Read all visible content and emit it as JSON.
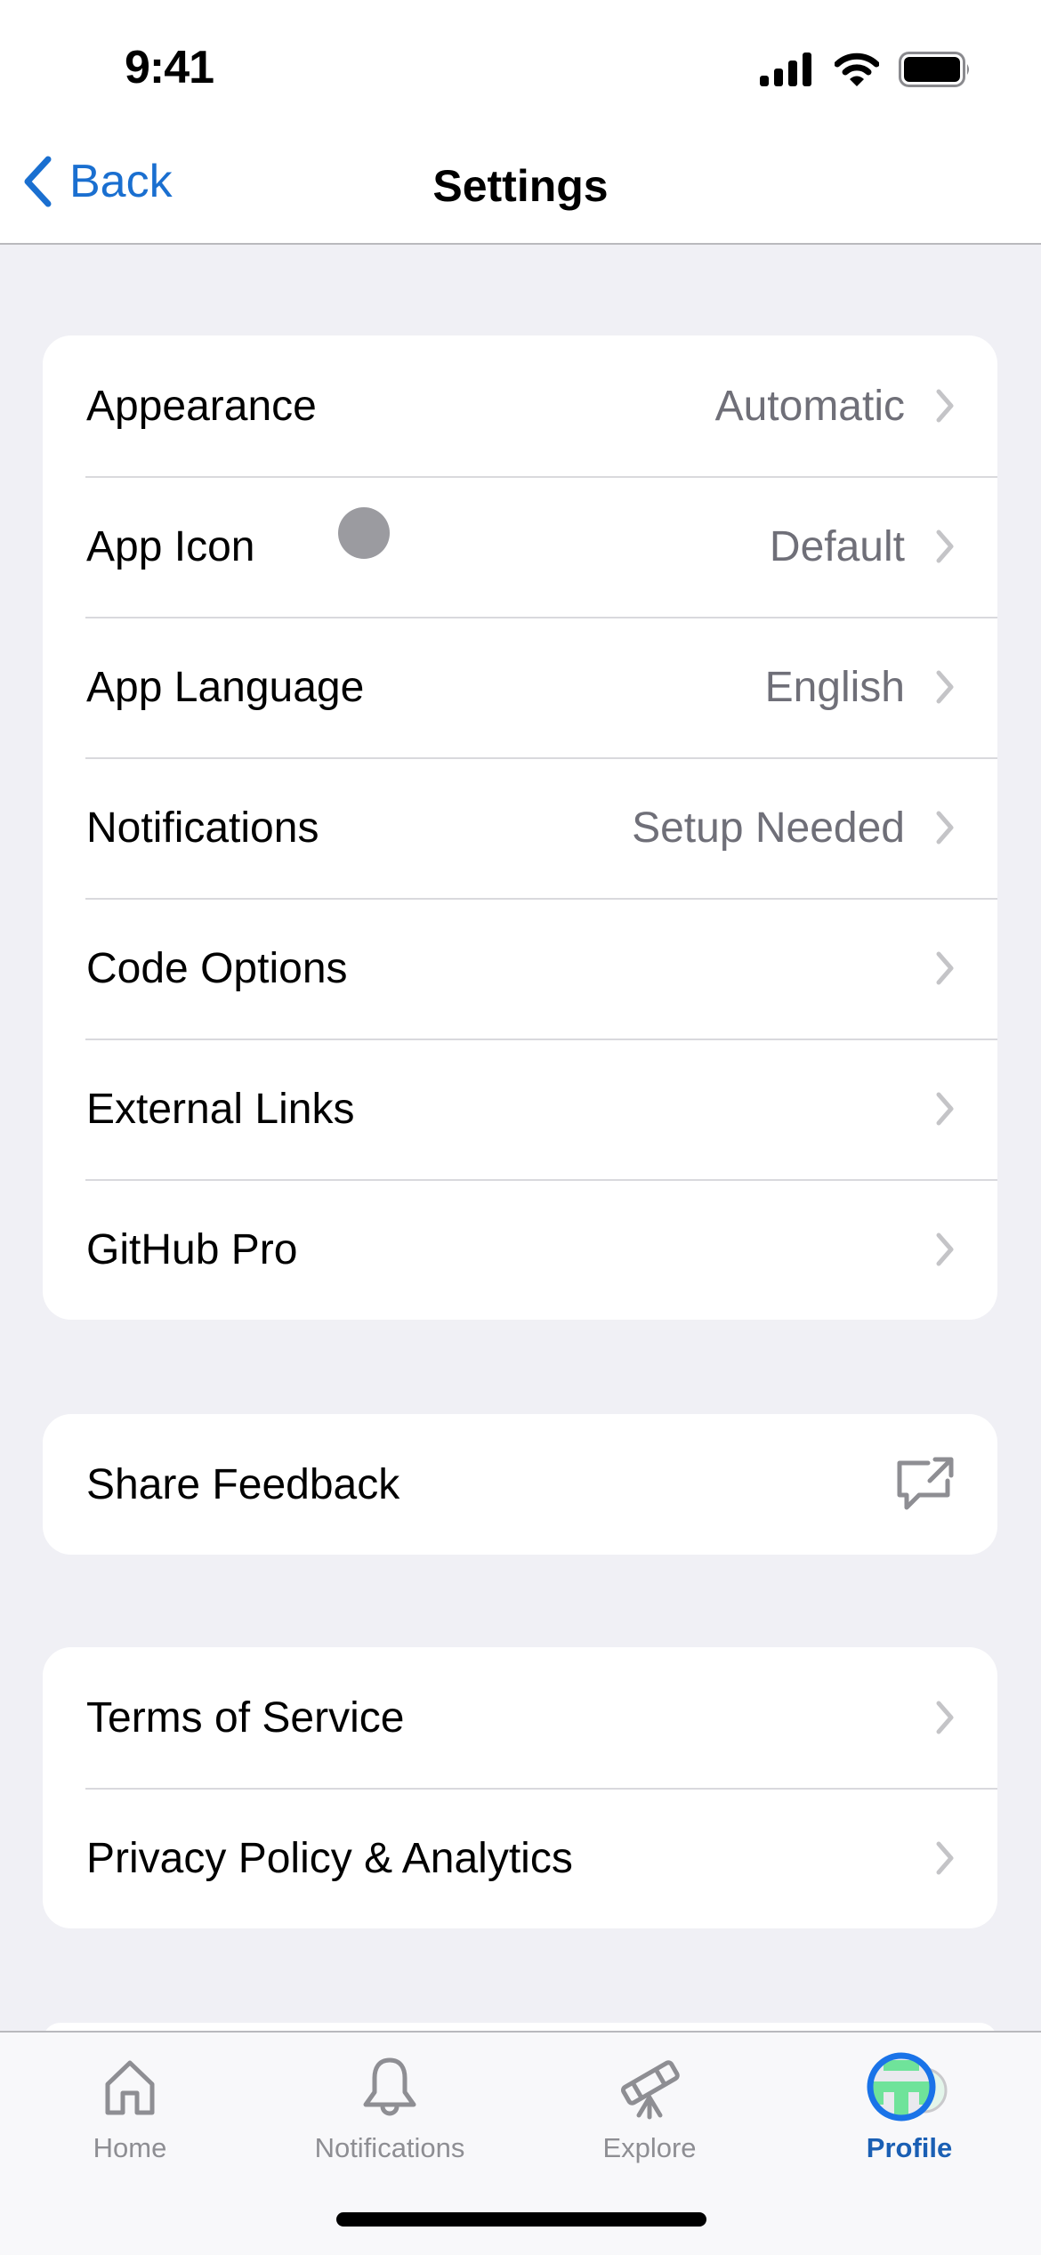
{
  "status_bar": {
    "time": "9:41",
    "icons": [
      "cellular-signal-icon",
      "wifi-icon",
      "battery-icon"
    ]
  },
  "nav": {
    "back_label": "Back",
    "back_icon": "chevron-left-icon",
    "title": "Settings"
  },
  "sections": [
    {
      "rows": [
        {
          "label": "Appearance",
          "value": "Automatic",
          "accessory": "chevron-right-icon"
        },
        {
          "label": "App Icon",
          "value": "Default",
          "accessory": "chevron-right-icon"
        },
        {
          "label": "App Language",
          "value": "English",
          "accessory": "chevron-right-icon"
        },
        {
          "label": "Notifications",
          "value": "Setup Needed",
          "accessory": "chevron-right-icon"
        },
        {
          "label": "Code Options",
          "value": "",
          "accessory": "chevron-right-icon"
        },
        {
          "label": "External Links",
          "value": "",
          "accessory": "chevron-right-icon"
        },
        {
          "label": "GitHub Pro",
          "value": "",
          "accessory": "chevron-right-icon"
        }
      ]
    },
    {
      "rows": [
        {
          "label": "Share Feedback",
          "value": "",
          "accessory": "external-feedback-icon"
        }
      ]
    },
    {
      "rows": [
        {
          "label": "Terms of Service",
          "value": "",
          "accessory": "chevron-right-icon"
        },
        {
          "label": "Privacy Policy & Analytics",
          "value": "",
          "accessory": "chevron-right-icon"
        }
      ]
    }
  ],
  "tab_bar": {
    "active": "Profile",
    "tabs": [
      {
        "label": "Home",
        "icon": "home-icon"
      },
      {
        "label": "Notifications",
        "icon": "bell-icon"
      },
      {
        "label": "Explore",
        "icon": "telescope-icon"
      },
      {
        "label": "Profile",
        "icon": "avatar-icon"
      }
    ]
  },
  "colors": {
    "accent": "#1a6fd0",
    "active_tab": "#1a5fb4",
    "background": "#f0f0f5",
    "secondary_text": "#6f6f78",
    "inactive_tab": "#8e8e93",
    "avatar_green": "#6fe39a"
  }
}
